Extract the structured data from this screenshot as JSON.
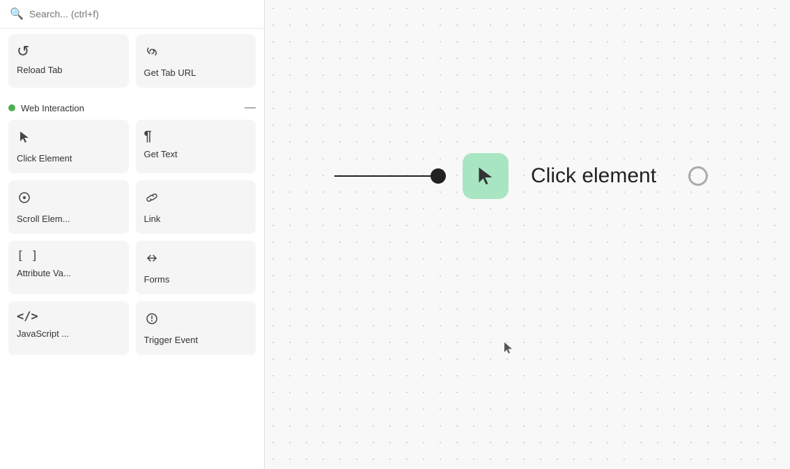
{
  "sidebar": {
    "search": {
      "placeholder": "Search... (ctrl+f)"
    },
    "top_row": [
      {
        "id": "reload-tab",
        "label": "Reload Tab",
        "icon": "↺"
      },
      {
        "id": "get-tab-url",
        "label": "Get Tab URL",
        "icon": "🔗"
      }
    ],
    "sections": [
      {
        "id": "web-interaction",
        "title": "Web Interaction",
        "dot_color": "#4caf50",
        "collapsed": false,
        "items": [
          {
            "id": "click-element",
            "label": "Click Element",
            "icon": "↖"
          },
          {
            "id": "get-text",
            "label": "Get Text",
            "icon": "¶"
          },
          {
            "id": "scroll-element",
            "label": "Scroll Elem...",
            "icon": "⊙"
          },
          {
            "id": "link",
            "label": "Link",
            "icon": "🔗"
          },
          {
            "id": "attribute-value",
            "label": "Attribute Va...",
            "icon": "[ ]"
          },
          {
            "id": "forms",
            "label": "Forms",
            "icon": "⟨I⟩"
          },
          {
            "id": "javascript",
            "label": "JavaScript ...",
            "icon": "</>"
          },
          {
            "id": "trigger-event",
            "label": "Trigger Event",
            "icon": "💡"
          }
        ]
      }
    ]
  },
  "canvas": {
    "node": {
      "label": "Click element",
      "icon": "↖"
    }
  },
  "colors": {
    "node_bg": "#a8e6c3",
    "section_dot": "#4caf50"
  }
}
